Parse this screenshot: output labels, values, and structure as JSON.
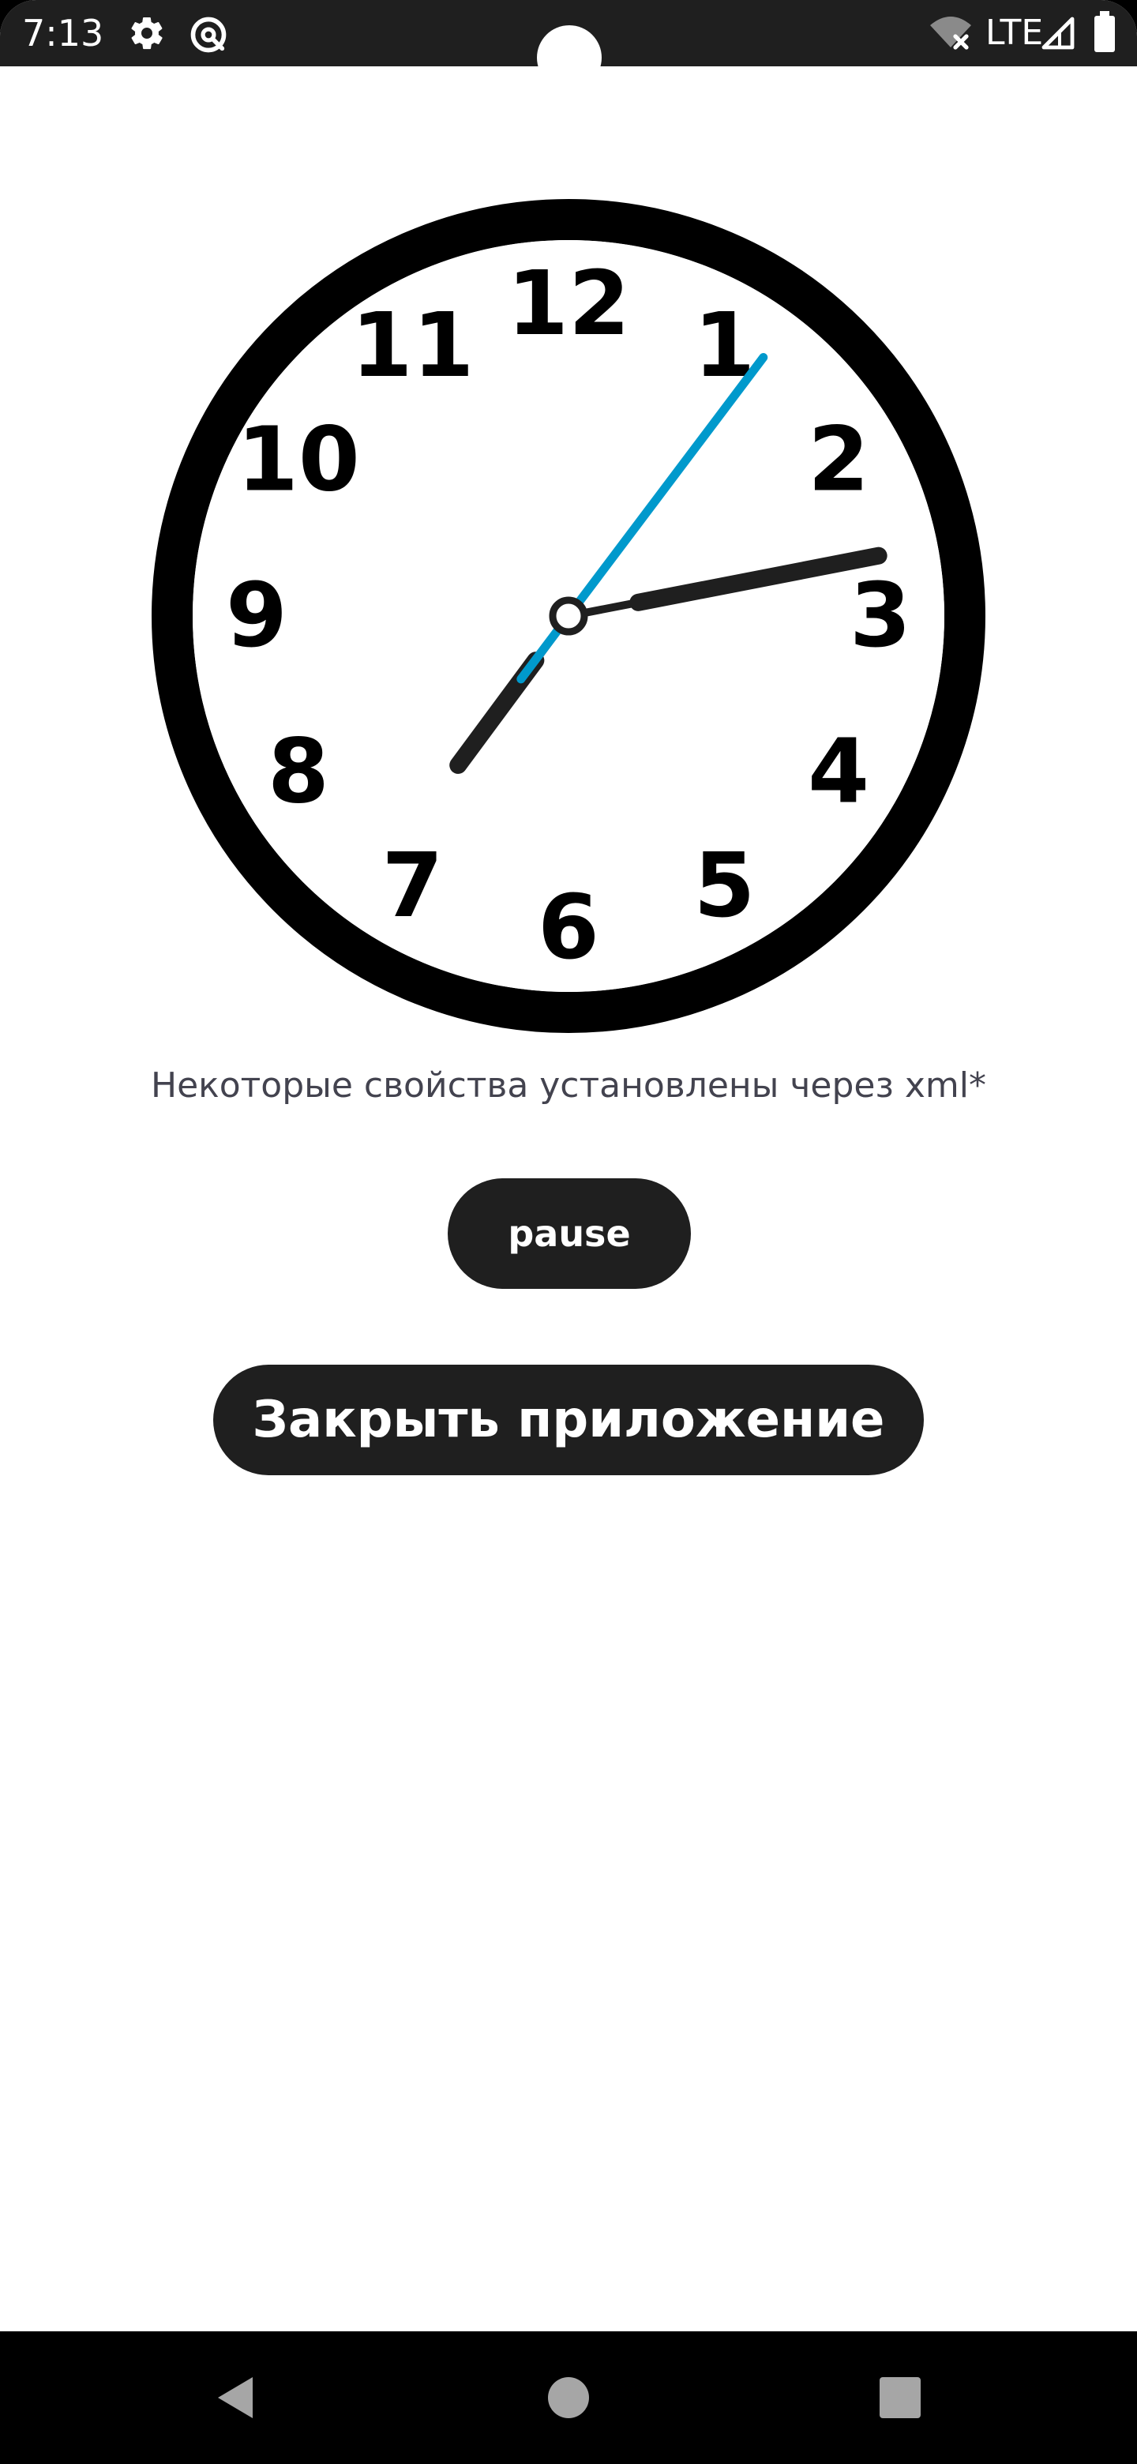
{
  "status_bar": {
    "time": "7:13",
    "network": "LTE",
    "icons": [
      "settings-icon",
      "assistant-icon",
      "wifi-off-icon",
      "signal-icon",
      "battery-icon"
    ]
  },
  "clock": {
    "numerals": [
      "12",
      "1",
      "2",
      "3",
      "4",
      "5",
      "6",
      "7",
      "8",
      "9",
      "10",
      "11"
    ],
    "colors": {
      "rim": "#000000",
      "face": "#ffffff",
      "numerals": "#000000",
      "hour_hand": "#1f1f1f",
      "minute_hand": "#1f1f1f",
      "second_hand": "#0099cc"
    },
    "time_shown": {
      "hour": 7,
      "minute": 13,
      "second": 6
    }
  },
  "caption": "Некоторые свойства установлены через xml*",
  "buttons": {
    "pause_label": "pause",
    "close_label": "Закрыть приложение"
  },
  "nav_bar": {
    "icons": [
      "back-icon",
      "home-icon",
      "recents-icon"
    ]
  }
}
